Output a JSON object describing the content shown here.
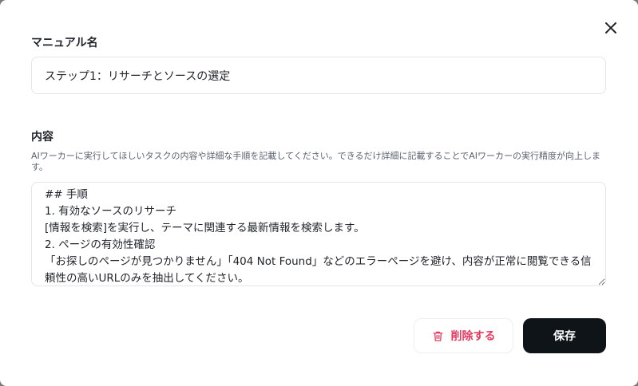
{
  "dialog": {
    "close_icon": "close-icon"
  },
  "manual_name": {
    "label": "マニュアル名",
    "value": "ステップ1：リサーチとソースの選定"
  },
  "content": {
    "label": "内容",
    "help": "AIワーカーに実行してほしいタスクの内容や詳細な手順を記載してください。できるだけ詳細に記載することでAIワーカーの実行精度が向上します。",
    "value": "## 手順\n1. 有効なソースのリサーチ\n[情報を検索]を実行し、テーマに関連する最新情報を検索します。\n2. ページの有効性確認\n「お探しのページが見つかりません」「404 Not Found」などのエラーページを避け、内容が正常に閲覧できる信頼性の高いURLのみを抽出してください。"
  },
  "actions": {
    "delete_label": "削除する",
    "delete_icon": "trash-icon",
    "save_label": "保存"
  },
  "colors": {
    "delete": "#e5395f",
    "save_bg": "#0f1419"
  }
}
